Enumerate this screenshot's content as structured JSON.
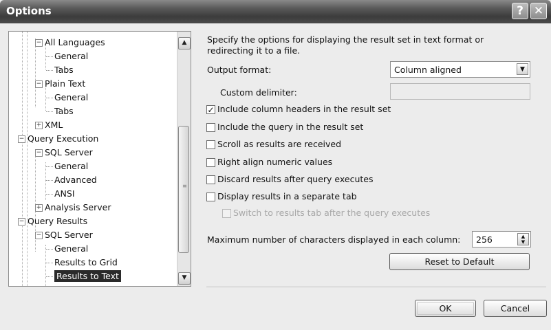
{
  "window": {
    "title": "Options",
    "help_glyph": "?",
    "close_glyph": "✕"
  },
  "tree": {
    "items": [
      {
        "label": "All Languages",
        "expander": "−"
      },
      {
        "label": "General"
      },
      {
        "label": "Tabs"
      },
      {
        "label": "Plain Text",
        "expander": "−"
      },
      {
        "label": "General"
      },
      {
        "label": "Tabs"
      },
      {
        "label": "XML",
        "expander": "+"
      },
      {
        "label": "Query Execution",
        "expander": "−"
      },
      {
        "label": "SQL Server",
        "expander": "−"
      },
      {
        "label": "General"
      },
      {
        "label": "Advanced"
      },
      {
        "label": "ANSI"
      },
      {
        "label": "Analysis Server",
        "expander": "+"
      },
      {
        "label": "Query Results",
        "expander": "−"
      },
      {
        "label": "SQL Server",
        "expander": "−"
      },
      {
        "label": "General"
      },
      {
        "label": "Results to Grid"
      },
      {
        "label": "Results to Text",
        "selected": true
      }
    ],
    "scroll_up_glyph": "▲",
    "scroll_down_glyph": "▼"
  },
  "panel": {
    "description": "Specify the options for displaying the result set in text format or redirecting it to a file.",
    "output_format_label": "Output format:",
    "output_format_value": "Column aligned",
    "custom_delimiter_label": "Custom delimiter:",
    "custom_delimiter_value": "",
    "checkboxes": [
      {
        "label": "Include column headers in the result set",
        "checked": true
      },
      {
        "label": "Include the query in the result set",
        "checked": false
      },
      {
        "label": "Scroll as results are received",
        "checked": false
      },
      {
        "label": "Right align numeric values",
        "checked": false
      },
      {
        "label": "Discard results after query executes",
        "checked": false
      },
      {
        "label": "Display results in a separate tab",
        "checked": false
      },
      {
        "label": "Switch to results tab after the query executes",
        "checked": false,
        "disabled": true
      }
    ],
    "max_chars_label": "Maximum number of characters displayed in each column:",
    "max_chars_value": "256",
    "reset_label": "Reset to Default"
  },
  "footer": {
    "ok_label": "OK",
    "cancel_label": "Cancel"
  },
  "colors": {
    "titlebar": "#4a4a4a",
    "selection": "#2a2a2a",
    "background": "#ececec"
  }
}
